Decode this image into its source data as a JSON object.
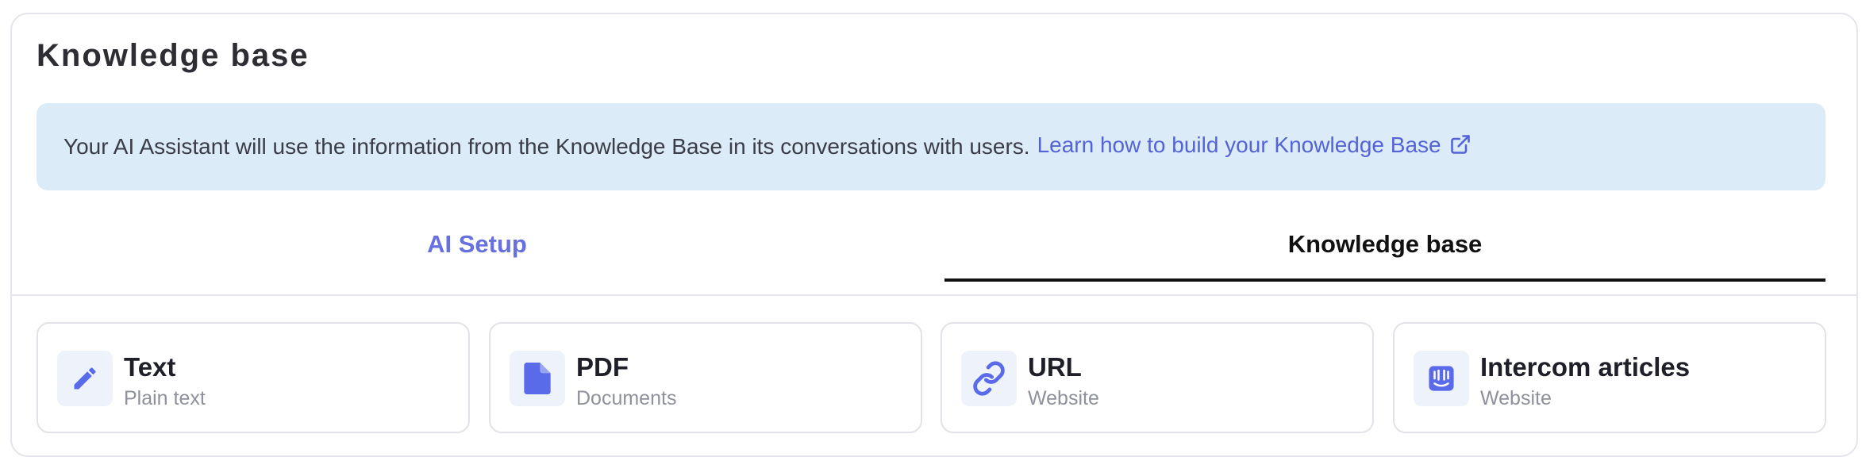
{
  "header": {
    "title": "Knowledge base"
  },
  "info": {
    "text": "Your AI Assistant will use the information from the Knowledge Base in its conversations with users.",
    "link_label": "Learn how to build your Knowledge Base",
    "link_icon": "external-link-icon"
  },
  "tabs": [
    {
      "label": "AI Setup",
      "active": false
    },
    {
      "label": "Knowledge base",
      "active": true
    }
  ],
  "sources": [
    {
      "name": "Text",
      "sub": "Plain text",
      "icon": "pencil-icon"
    },
    {
      "name": "PDF",
      "sub": "Documents",
      "icon": "document-icon"
    },
    {
      "name": "URL",
      "sub": "Website",
      "icon": "link-icon"
    },
    {
      "name": "Intercom articles",
      "sub": "Website",
      "icon": "intercom-icon"
    }
  ],
  "colors": {
    "accent": "#5563d8",
    "info_bg": "#dbebf7",
    "icon_bg": "#eef2fb",
    "active_tab": "#111111"
  }
}
